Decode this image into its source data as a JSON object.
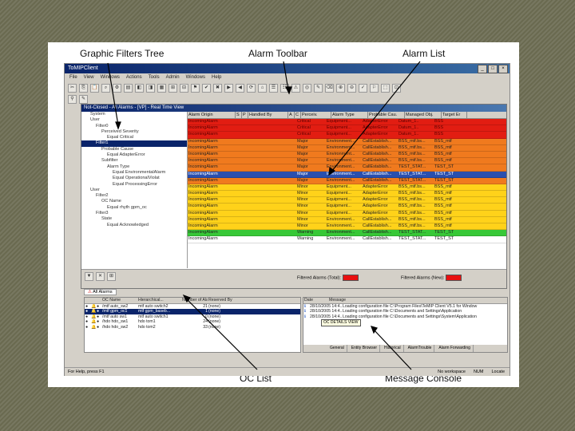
{
  "callouts": {
    "graphic_filters_tree": "Graphic Filters Tree",
    "alarm_toolbar": "Alarm Toolbar",
    "alarm_list": "Alarm List",
    "oc_list": "OC List",
    "message_console": "Message Console"
  },
  "window": {
    "title": "ToMIPClient",
    "menu": [
      "File",
      "View",
      "Windows",
      "Actions",
      "Tools",
      "Admin",
      "Windows",
      "Help"
    ]
  },
  "alarm_window": {
    "title": "Not-Closed - All Alarms - [VP] - Real Time View",
    "columns": [
      "Alarm Origin",
      "S",
      "P",
      "Handled By",
      "A",
      "C",
      "Perceiv.",
      "Alarm Type",
      "Probable Cau.",
      "Managed Obj.",
      "Target Er"
    ],
    "rows": [
      {
        "origin": "IncomingAlarm",
        "sev": "Critical",
        "type": "Equipment...",
        "cause": "AdapterError",
        "obj": "Datum_1..",
        "target": "BSS",
        "color": "#e21d12"
      },
      {
        "origin": "IncomingAlarm",
        "sev": "Critical",
        "type": "Equipment...",
        "cause": "AdapterError",
        "obj": "Datum_1..",
        "target": "BSS",
        "color": "#e21d12"
      },
      {
        "origin": "IncomingAlarm",
        "sev": "Critical",
        "type": "Equipment...",
        "cause": "AdapterError",
        "obj": "Datum_1..",
        "target": "BSS",
        "color": "#e21d12"
      },
      {
        "origin": "IncomingAlarm",
        "sev": "Major",
        "type": "Environment...",
        "cause": "CallEstablish...",
        "obj": "BSS_mtf.bs...",
        "target": "BSS_mtf",
        "color": "#f07a1e"
      },
      {
        "origin": "IncomingAlarm",
        "sev": "Major",
        "type": "Environment...",
        "cause": "CallEstablish...",
        "obj": "BSS_mtf.bs...",
        "target": "BSS_mtf",
        "color": "#f07a1e"
      },
      {
        "origin": "IncomingAlarm",
        "sev": "Major",
        "type": "Environment...",
        "cause": "CallEstablish...",
        "obj": "BSS_mtf.bs...",
        "target": "BSS_mtf",
        "color": "#f07a1e"
      },
      {
        "origin": "IncomingAlarm",
        "sev": "Major",
        "type": "Environment...",
        "cause": "CallEstablish...",
        "obj": "BSS_mtf.bs...",
        "target": "BSS_mtf",
        "color": "#f07a1e"
      },
      {
        "origin": "IncomingAlarm",
        "sev": "Major",
        "type": "Environment...",
        "cause": "CallEstablish...",
        "obj": "TEST_STAT...",
        "target": "TEST_ST",
        "color": "#f07a1e"
      },
      {
        "origin": "IncomingAlarm",
        "sev": "Major",
        "type": "Environment...",
        "cause": "CallEstablish...",
        "obj": "TEST_STAT...",
        "target": "TEST_ST",
        "color": "#2a4fae"
      },
      {
        "origin": "IncomingAlarm",
        "sev": "Major",
        "type": "Environment...",
        "cause": "CallEstablish...",
        "obj": "TEST_STAT...",
        "target": "TEST_ST",
        "color": "#f07a1e"
      },
      {
        "origin": "IncomingAlarm",
        "sev": "Minor",
        "type": "Equipment...",
        "cause": "AdapterError",
        "obj": "BSS_mtf.bs...",
        "target": "BSS_mtf",
        "color": "#ffd21a"
      },
      {
        "origin": "IncomingAlarm",
        "sev": "Minor",
        "type": "Equipment...",
        "cause": "AdapterError",
        "obj": "BSS_mtf.bs...",
        "target": "BSS_mtf",
        "color": "#ffd21a"
      },
      {
        "origin": "IncomingAlarm",
        "sev": "Minor",
        "type": "Equipment...",
        "cause": "AdapterError",
        "obj": "BSS_mtf.bs...",
        "target": "BSS_mtf",
        "color": "#ffd21a"
      },
      {
        "origin": "IncomingAlarm",
        "sev": "Minor",
        "type": "Equipment...",
        "cause": "AdapterError",
        "obj": "BSS_mtf.bs...",
        "target": "BSS_mtf",
        "color": "#ffd21a"
      },
      {
        "origin": "IncomingAlarm",
        "sev": "Minor",
        "type": "Equipment...",
        "cause": "AdapterError",
        "obj": "BSS_mtf.bs...",
        "target": "BSS_mtf",
        "color": "#ffd21a"
      },
      {
        "origin": "IncomingAlarm",
        "sev": "Minor",
        "type": "Environment...",
        "cause": "CallEstablish...",
        "obj": "BSS_mtf.bs...",
        "target": "BSS_mtf",
        "color": "#ffd21a"
      },
      {
        "origin": "IncomingAlarm",
        "sev": "Minor",
        "type": "Environment...",
        "cause": "CallEstablish...",
        "obj": "BSS_mtf.bs...",
        "target": "BSS_mtf",
        "color": "#ffd21a"
      },
      {
        "origin": "IncomingAlarm",
        "sev": "Warning",
        "type": "Environment...",
        "cause": "CallEstablish...",
        "obj": "TEST_STAT...",
        "target": "TEST_ST",
        "color": "#37c837"
      },
      {
        "origin": "IncomingAlarm",
        "sev": "Warning",
        "type": "Environment...",
        "cause": "CallEstablish...",
        "obj": "TEST_STAT...",
        "target": "TEST_ST",
        "color": "#ffffff"
      }
    ],
    "footer_left": "Filtered Alarms (Total):",
    "footer_right": "Filtered Alarms (New):",
    "tab": "All Alarms"
  },
  "tree": [
    "System",
    "User",
    "Filter0",
    "Perceived Severity",
    "Equal Critical",
    "Filter1",
    "Probable Cause",
    "Equal AdapterError",
    "Subfilter",
    "Alarm Type",
    "Equal EnvironmentalAlarm",
    "Equal OperationalViolat",
    "Equal ProcessingError",
    "User",
    "Filter2",
    "OC Name",
    "Equal rhyth gpm_oc",
    "Filter3",
    "State",
    "Equal Acknowledged"
  ],
  "oc_list": {
    "columns": [
      "",
      "",
      "",
      "OC Name",
      "Hierarchical...",
      "Number of Alarms",
      "Reserved By"
    ],
    "rows": [
      {
        "name": "/mtf auto_sw2",
        "hier": "mtf auto switch2",
        "count": "21",
        "res": "(none)",
        "selected": false
      },
      {
        "name": "/mtf gpm_oc1",
        "hier": "mtf gpm_baseb...",
        "count": "1",
        "res": "(none)",
        "selected": true
      },
      {
        "name": "/mtf auto sw1",
        "hier": "mtf auto switch1",
        "count": "0",
        "res": "(none)",
        "selected": false
      },
      {
        "name": "/hdo hdo_sw1",
        "hier": "hdo tom1",
        "count": "24",
        "res": "(none)",
        "selected": false
      },
      {
        "name": "/hdo hdo_sw2",
        "hier": "hdo tom2",
        "count": "33",
        "res": "(none)",
        "selected": false
      }
    ]
  },
  "message_console": {
    "columns": [
      "Date",
      "Message"
    ],
    "rows": [
      {
        "date": "28/10/2005 14:4...",
        "msg": "Loading configuration file C:\\Program Files\\TeMIP Client V5.1 for Window"
      },
      {
        "date": "28/10/2005 14:4...",
        "msg": "Loading configuration file C:\\Documents and Settings\\Application"
      },
      {
        "date": "28/10/2005 14:4...",
        "msg": "Loading configuration file C:\\Documents and Settings\\System\\Application"
      }
    ],
    "tooltip": "OC DETAILS VIEW",
    "tabs": [
      "General",
      "Entity Browser",
      "Historical",
      "AlarmTrouble",
      "Alarm Forwarding"
    ]
  },
  "statusbar": {
    "left": "For Help, press F1",
    "right": [
      "No workspace",
      "NUM",
      "Locate"
    ]
  }
}
